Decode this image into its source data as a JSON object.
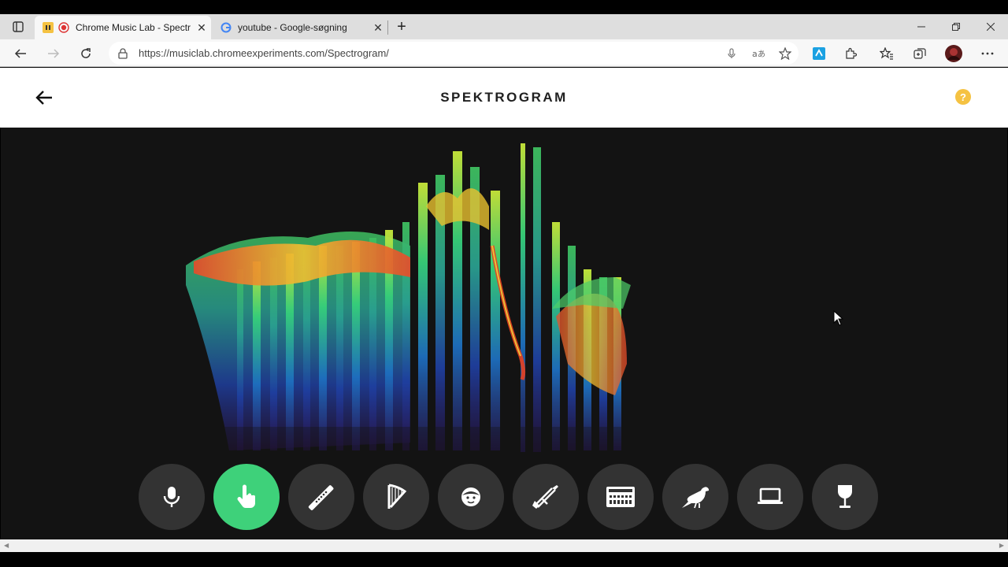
{
  "browser": {
    "tabs": [
      {
        "label": "Chrome Music Lab - Spectr",
        "active": true,
        "icon": "recording-icon"
      },
      {
        "label": "youtube - Google-søgning",
        "active": false,
        "icon": "google-icon"
      }
    ],
    "new_tab": "+",
    "url": "https://musiclab.chromeexperiments.com/Spectrogram/",
    "window_controls": [
      "minimize",
      "restore",
      "close"
    ]
  },
  "page": {
    "title": "SPEKTROGRAM",
    "help": "?"
  },
  "instruments": [
    {
      "name": "microphone-icon",
      "active": false
    },
    {
      "name": "finger-pointer-icon",
      "active": true
    },
    {
      "name": "flute-icon",
      "active": false
    },
    {
      "name": "harp-icon",
      "active": false
    },
    {
      "name": "face-voice-icon",
      "active": false
    },
    {
      "name": "trombone-icon",
      "active": false
    },
    {
      "name": "synthesizer-icon",
      "active": false
    },
    {
      "name": "bird-icon",
      "active": false
    },
    {
      "name": "laptop-icon",
      "active": false
    },
    {
      "name": "wine-glass-icon",
      "active": false
    }
  ],
  "colors": {
    "active_instrument": "#3ed17a",
    "instrument_bg": "#333333",
    "canvas_bg": "#131313",
    "help_icon": "#f5c242"
  }
}
